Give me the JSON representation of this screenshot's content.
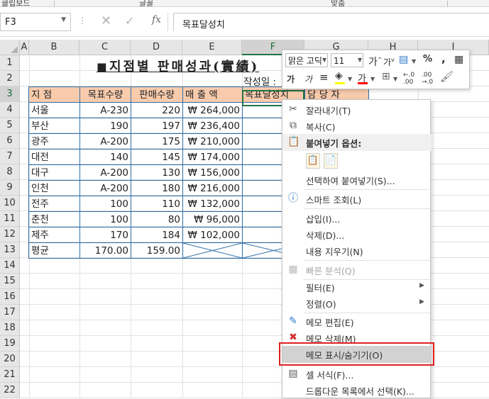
{
  "ribbon_group_labels": [
    "클립보드",
    "글꼴",
    "맞춤"
  ],
  "formula_bar": {
    "name_box": "F3",
    "content": "목표달성치",
    "cancel_icon": "close-icon",
    "enter_icon": "check-icon",
    "function_label": "fx"
  },
  "columns": [
    "A",
    "B",
    "C",
    "D",
    "E",
    "F",
    "G",
    "H",
    "I"
  ],
  "rows": [
    "1",
    "2",
    "3",
    "4",
    "5",
    "6",
    "7",
    "8",
    "9",
    "10",
    "11",
    "12",
    "13",
    "14",
    "15",
    "16",
    "17",
    "18",
    "19",
    "20",
    "21",
    "22"
  ],
  "sheet": {
    "title": "◼지점별 판매성과(實績)",
    "date_label": "작성일 :",
    "headers": {
      "B": "지          점",
      "C": "목표수량",
      "D": "판매수량",
      "E": "매    출    액",
      "F": "목표달성치",
      "G": "담    당    자"
    },
    "data_rows": [
      {
        "branch": "서울",
        "target": "A-230",
        "sold": "220",
        "sales": "₩ 264,000"
      },
      {
        "branch": "부산",
        "target": "190",
        "sold": "197",
        "sales": "₩ 236,400"
      },
      {
        "branch": "광주",
        "target": "A-200",
        "sold": "175",
        "sales": "₩ 210,000"
      },
      {
        "branch": "대전",
        "target": "140",
        "sold": "145",
        "sales": "₩ 174,000"
      },
      {
        "branch": "대구",
        "target": "A-200",
        "sold": "130",
        "sales": "₩ 156,000"
      },
      {
        "branch": "인천",
        "target": "A-200",
        "sold": "180",
        "sales": "₩ 216,000"
      },
      {
        "branch": "전주",
        "target": "100",
        "sold": "110",
        "sales": "₩ 132,000"
      },
      {
        "branch": "춘천",
        "target": "100",
        "sold": "80",
        "sales": "₩   96,000"
      },
      {
        "branch": "제주",
        "target": "170",
        "sold": "184",
        "sales": "₩ 102,000"
      }
    ],
    "avg_row": {
      "branch": "평균",
      "target": "170.00",
      "sold": "159.00"
    }
  },
  "mini_toolbar": {
    "font_name": "맑은 고딕",
    "font_size": "11",
    "percent": "%",
    "comma": ",",
    "bold": "가",
    "italic": "가"
  },
  "context_menu": {
    "items": [
      {
        "label": "잘라내기(T)",
        "icon": "scissors-icon"
      },
      {
        "label": "복사(C)",
        "icon": "copy-icon"
      },
      {
        "label": "붙여넣기 옵션:",
        "icon": "paste-icon"
      },
      {
        "label": "선택하여 붙여넣기(S)..."
      },
      {
        "label": "스마트 조회(L)",
        "icon": "smart-lookup-icon"
      },
      {
        "label": "삽입(I)..."
      },
      {
        "label": "삭제(D)..."
      },
      {
        "label": "내용 지우기(N)"
      },
      {
        "label": "빠른 분석(Q)",
        "icon": "quick-analysis-icon"
      },
      {
        "label": "필터(E)"
      },
      {
        "label": "정렬(O)"
      },
      {
        "label": "메모 편집(E)",
        "icon": "edit-comment-icon"
      },
      {
        "label": "메모 삭제(M)",
        "icon": "delete-comment-icon"
      },
      {
        "label": "메모 표시/숨기기(O)"
      },
      {
        "label": "셀 서식(F)...",
        "icon": "format-cells-icon"
      },
      {
        "label": "드롭다운 목록에서 선택(K)..."
      }
    ]
  },
  "colors": {
    "header_fill": "#f8cbad",
    "border_blue": "#2f6fa8",
    "highlight_red": "#e02020",
    "excel_green": "#217346"
  }
}
